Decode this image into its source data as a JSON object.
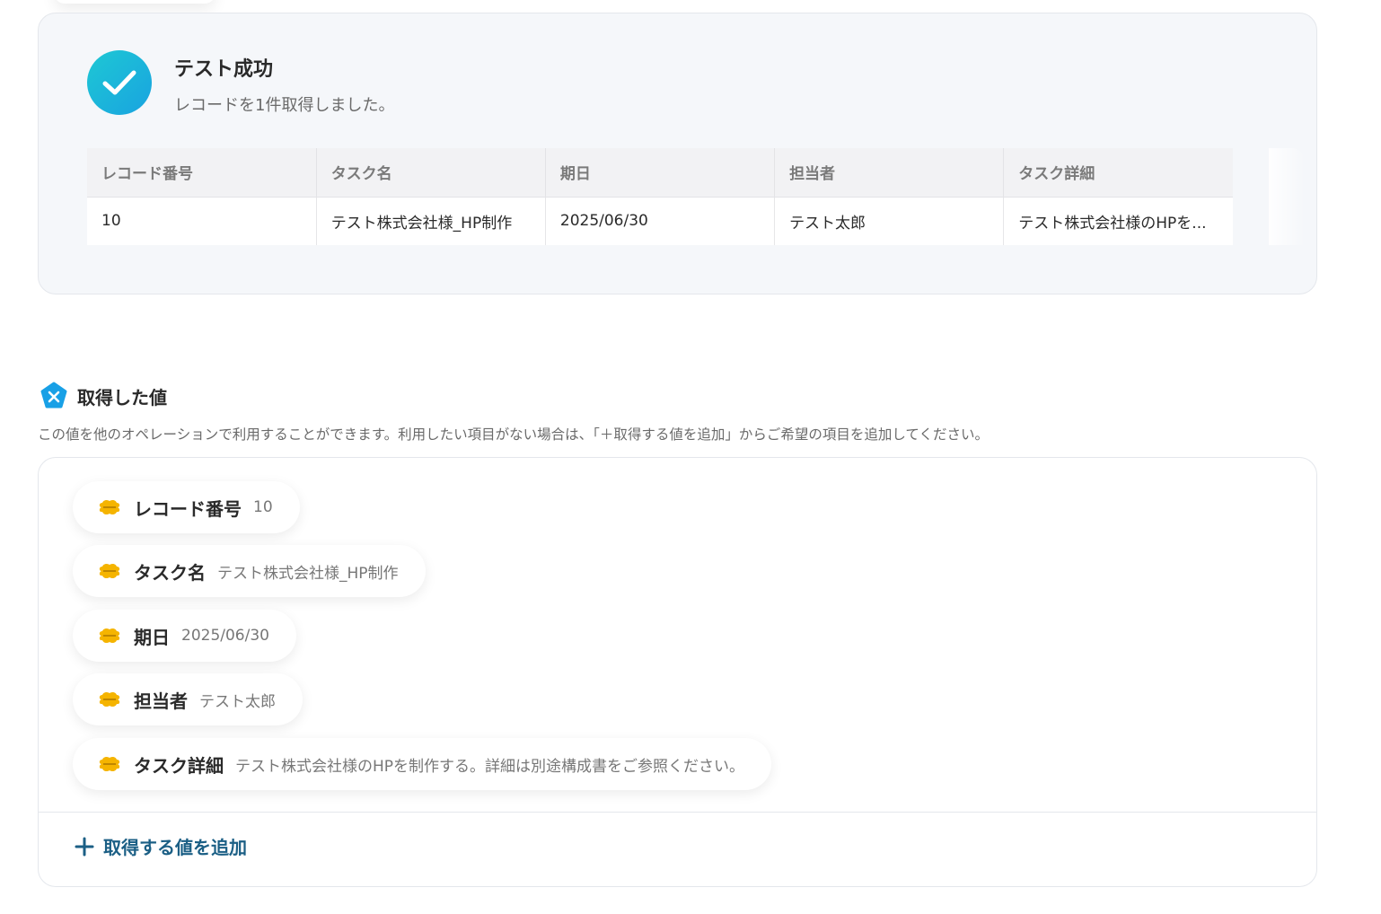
{
  "result": {
    "title": "テスト成功",
    "subtitle": "レコードを1件取得しました。",
    "columns": [
      "レコード番号",
      "タスク名",
      "期日",
      "担当者",
      "タスク詳細"
    ],
    "row": [
      "10",
      "テスト株式会社様_HP制作",
      "2025/06/30",
      "テスト太郎",
      "テスト株式会社様のHPを..."
    ]
  },
  "section": {
    "title": "取得した値",
    "description": "この値を他のオペレーションで利用することができます。利用したい項目がない場合は、「＋取得する値を追加」からご希望の項目を追加してください。"
  },
  "values": [
    {
      "label": "レコード番号",
      "value": "10"
    },
    {
      "label": "タスク名",
      "value": "テスト株式会社様_HP制作"
    },
    {
      "label": "期日",
      "value": "2025/06/30"
    },
    {
      "label": "担当者",
      "value": "テスト太郎"
    },
    {
      "label": "タスク詳細",
      "value": "テスト株式会社様のHPを制作する。詳細は別途構成書をご参照ください。"
    }
  ],
  "add_button": {
    "label": "取得する値を追加"
  },
  "colors": {
    "accent": "#1b5f85",
    "success": "#19a3e0",
    "kintone": "#f5b400"
  },
  "icons": {
    "success": "check-circle-icon",
    "section": "variable-icon",
    "app": "kintone-icon",
    "add": "plus-icon"
  }
}
